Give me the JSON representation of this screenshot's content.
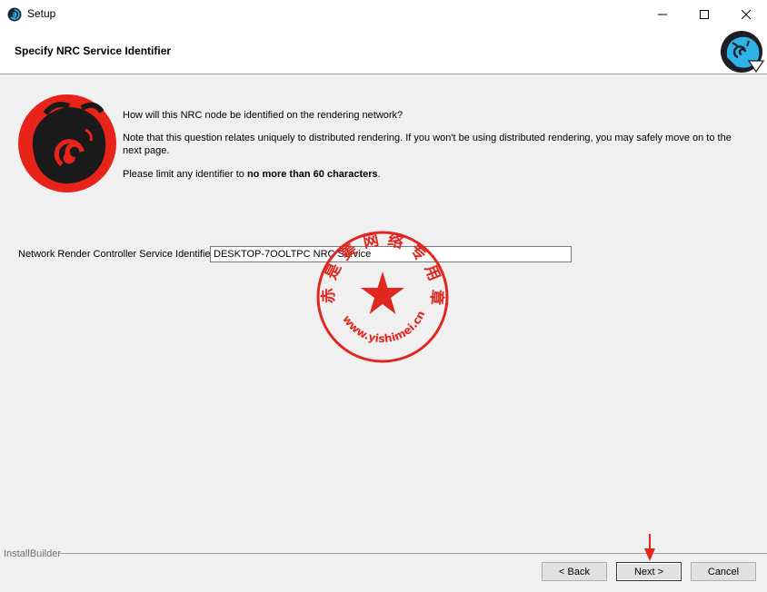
{
  "window": {
    "title": "Setup"
  },
  "header": {
    "title": "Specify NRC Service Identifier"
  },
  "content": {
    "question": "How will this NRC node be identified on the rendering network?",
    "note": "Note that this question relates uniquely to distributed rendering. If you won't be using distributed rendering, you may safely move on to the next page.",
    "limit_prefix": "Please limit any identifier to ",
    "limit_bold": "no more than 60 characters",
    "limit_suffix": "."
  },
  "form": {
    "label": "Network Render Controller Service Identifier",
    "value": "DESKTOP-7OOLTPC NRC Service"
  },
  "stamp": {
    "text": "赤 是 美 网 络 专 用 章",
    "url": "www.yishimei.cn"
  },
  "footer": {
    "brand": "InstallBuilder"
  },
  "buttons": {
    "back": "< Back",
    "next": "Next >",
    "cancel": "Cancel"
  },
  "colors": {
    "accent_red": "#e8231a",
    "stamp_red": "#e0271f",
    "header_bg": "#ffffff",
    "body_bg": "#f0f0f0"
  },
  "icons": [
    "app-icon",
    "minimize-icon",
    "maximize-icon",
    "close-icon",
    "logo-icon",
    "arrow-down-icon",
    "star-icon"
  ]
}
